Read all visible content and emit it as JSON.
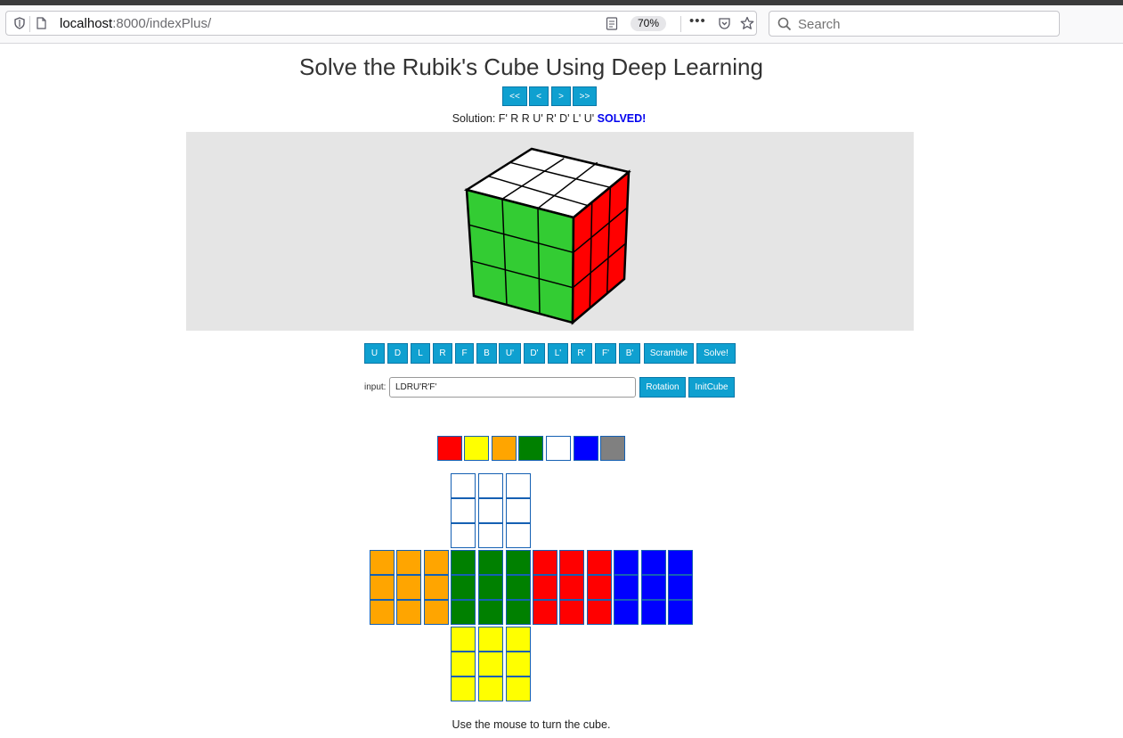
{
  "browser": {
    "url_host": "localhost",
    "url_path": ":8000/indexPlus/",
    "zoom": "70%",
    "more_icon": "•••",
    "search_placeholder": "Search"
  },
  "page": {
    "title": "Solve the Rubik's Cube Using Deep Learning",
    "nav_buttons": [
      "<<",
      "<",
      ">",
      ">>"
    ],
    "solution_label": "Solution: F' R R U' R' D' L' U'",
    "solved_text": "SOLVED!",
    "move_buttons": [
      "U",
      "D",
      "L",
      "R",
      "F",
      "B",
      "U'",
      "D'",
      "L'",
      "R'",
      "F'",
      "B'",
      "Scramble",
      "Solve!"
    ],
    "input_label": "input:",
    "input_value": "LDRU'R'F'",
    "rotation_button": "Rotation",
    "initcube_button": "InitCube",
    "footer": "Use the mouse to turn the cube."
  },
  "palette": [
    {
      "name": "red",
      "color": "#ff0000"
    },
    {
      "name": "yellow",
      "color": "#ffff00"
    },
    {
      "name": "orange",
      "color": "#ffa500"
    },
    {
      "name": "green",
      "color": "#008000"
    },
    {
      "name": "white",
      "color": "#ffffff"
    },
    {
      "name": "blue",
      "color": "#0000ff"
    },
    {
      "name": "gray",
      "color": "#808080"
    }
  ],
  "net_faces": [
    {
      "face": "U",
      "color": "#ffffff"
    },
    {
      "face": "L",
      "color": "#ffa500"
    },
    {
      "face": "F",
      "color": "#008000"
    },
    {
      "face": "R",
      "color": "#ff0000"
    },
    {
      "face": "B",
      "color": "#0000ff"
    },
    {
      "face": "D",
      "color": "#ffff00"
    }
  ],
  "cube3d": {
    "top_color": "#ffffff",
    "front_color": "#33cc33",
    "right_color": "#ff0000",
    "edge_color": "#000000",
    "background": "#e5e5e5"
  }
}
